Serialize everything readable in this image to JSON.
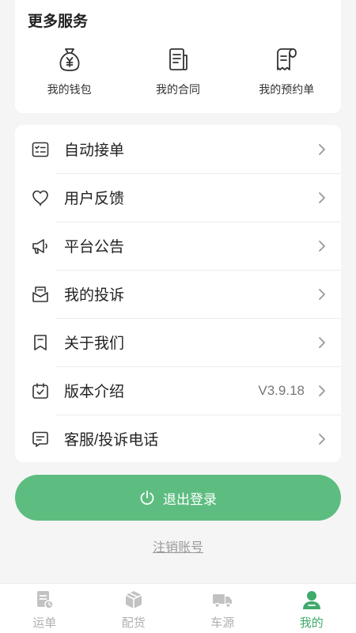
{
  "services": {
    "title": "更多服务",
    "items": [
      {
        "label": "我的钱包",
        "icon": "wallet-icon"
      },
      {
        "label": "我的合同",
        "icon": "contract-icon"
      },
      {
        "label": "我的预约单",
        "icon": "reservation-icon"
      }
    ]
  },
  "menu": {
    "items": [
      {
        "label": "自动接单",
        "icon": "auto-order-icon",
        "value": ""
      },
      {
        "label": "用户反馈",
        "icon": "feedback-heart-icon",
        "value": ""
      },
      {
        "label": "平台公告",
        "icon": "megaphone-icon",
        "value": ""
      },
      {
        "label": "我的投诉",
        "icon": "complaint-mail-icon",
        "value": ""
      },
      {
        "label": "关于我们",
        "icon": "about-bookmark-icon",
        "value": ""
      },
      {
        "label": "版本介绍",
        "icon": "version-calendar-icon",
        "value": "V3.9.18"
      },
      {
        "label": "客服/投诉电话",
        "icon": "service-chat-icon",
        "value": ""
      }
    ]
  },
  "logout": {
    "label": "退出登录",
    "icon": "power-icon"
  },
  "deregister": {
    "label": "注销账号"
  },
  "tabbar": {
    "items": [
      {
        "label": "运单",
        "icon": "waybill-icon",
        "active": false
      },
      {
        "label": "配货",
        "icon": "package-icon",
        "active": false
      },
      {
        "label": "车源",
        "icon": "truck-icon",
        "active": false
      },
      {
        "label": "我的",
        "icon": "user-icon",
        "active": true
      }
    ]
  },
  "colors": {
    "accent": "#5dbd80",
    "active_tab": "#3faa6c",
    "inactive_tab": "#b0b0b0"
  }
}
